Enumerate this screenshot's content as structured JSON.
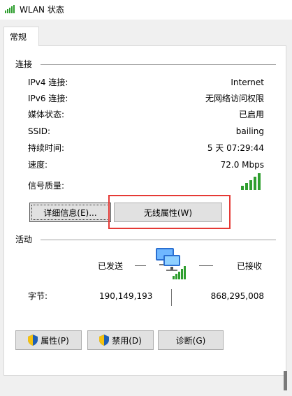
{
  "window": {
    "title": "WLAN 状态"
  },
  "tabs": [
    {
      "label": "常规"
    }
  ],
  "connection": {
    "section_title": "连接",
    "rows": [
      {
        "label": "IPv4 连接:",
        "value": "Internet"
      },
      {
        "label": "IPv6 连接:",
        "value": "无网络访问权限"
      },
      {
        "label": "媒体状态:",
        "value": "已启用"
      },
      {
        "label": "SSID:",
        "value": "bailing"
      },
      {
        "label": "持续时间:",
        "value": "5 天 07:29:44"
      },
      {
        "label": "速度:",
        "value": "72.0 Mbps"
      }
    ],
    "signal_label": "信号质量:",
    "signal_icon": "signal-strength-full-icon",
    "details_button": "详细信息(E)...",
    "wireless_props_button": "无线属性(W)"
  },
  "activity": {
    "section_title": "活动",
    "sent_label": "已发送",
    "received_label": "已接收",
    "network_icon": "network-computers-icon",
    "bytes_label": "字节:",
    "bytes_sent": "190,149,193",
    "bytes_received": "868,295,008"
  },
  "buttons": {
    "properties": "属性(P)",
    "disable": "禁用(D)",
    "diagnose": "诊断(G)"
  },
  "colors": {
    "signal_green": "#2e9e2e",
    "highlight_red": "#e53935",
    "shield_blue": "#1f5fb4",
    "shield_yellow": "#f4c10f"
  }
}
